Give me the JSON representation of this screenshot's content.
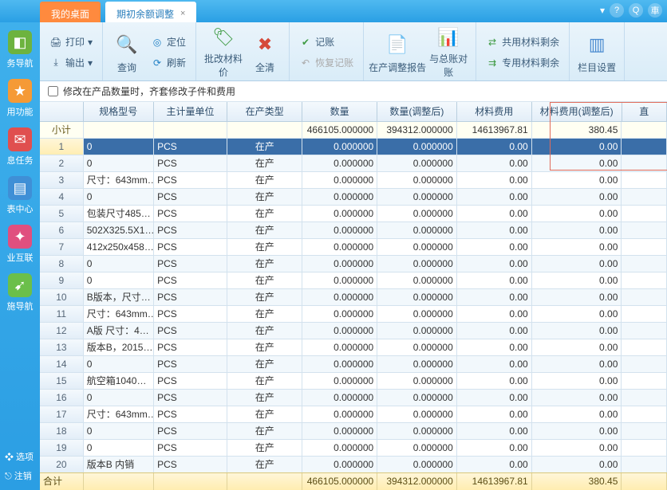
{
  "tabs": {
    "desktop": "我的桌面",
    "current": "期初余额调整"
  },
  "topbar_icons": {
    "help": "?",
    "search": "Q",
    "more": "車"
  },
  "sidebar": {
    "items": [
      {
        "label": "务导航",
        "icon_bg": "#6db33f",
        "icon": "◧"
      },
      {
        "label": "用功能",
        "icon_bg": "#f59a36",
        "icon": "★"
      },
      {
        "label": "息任务",
        "icon_bg": "#e04f4f",
        "icon": "✉"
      },
      {
        "label": "表中心",
        "icon_bg": "#3f8fd6",
        "icon": "▤"
      },
      {
        "label": "业互联",
        "icon_bg": "#e04f7f",
        "icon": "✦"
      },
      {
        "label": "施导航",
        "icon_bg": "#6bbf4a",
        "icon": "➹"
      }
    ],
    "bottom": {
      "options": "❖ 选项",
      "logout": "⎋ 注销"
    }
  },
  "ribbon": {
    "print": "打印",
    "export": "输出",
    "query": "查询",
    "locate": "定位",
    "refresh": "刷新",
    "batch_price": "批改材料价",
    "clear_all": "全清",
    "post": "记账",
    "restore_post": "恢复记账",
    "wip_report": "在产调整报告",
    "recon": "与总账对账",
    "share_mat": "共用材料剩余",
    "dedicate_mat": "专用材料剩余",
    "col_setup": "栏目设置"
  },
  "option": {
    "label": "修改在产品数量时，齐套修改子件和费用"
  },
  "grid": {
    "headers": [
      "",
      "规格型号",
      "主计量单位",
      "在产类型",
      "数量",
      "数量(调整后)",
      "材料费用",
      "材料费用(调整后)",
      "直"
    ],
    "subtotal_label": "小计",
    "subtotal": [
      "",
      "",
      "",
      "466105.000000",
      "394312.000000",
      "14613967.81",
      "380.45",
      ""
    ],
    "rows": [
      {
        "n": "1",
        "spec": "0",
        "uom": "PCS",
        "type": "在产",
        "qty": "0.000000",
        "qtya": "0.000000",
        "mat": "0.00",
        "mata": "0.00"
      },
      {
        "n": "2",
        "spec": "0",
        "uom": "PCS",
        "type": "在产",
        "qty": "0.000000",
        "qtya": "0.000000",
        "mat": "0.00",
        "mata": "0.00"
      },
      {
        "n": "3",
        "spec": "尺寸：643mm…",
        "uom": "PCS",
        "type": "在产",
        "qty": "0.000000",
        "qtya": "0.000000",
        "mat": "0.00",
        "mata": "0.00"
      },
      {
        "n": "4",
        "spec": "0",
        "uom": "PCS",
        "type": "在产",
        "qty": "0.000000",
        "qtya": "0.000000",
        "mat": "0.00",
        "mata": "0.00"
      },
      {
        "n": "5",
        "spec": "包装尺寸485…",
        "uom": "PCS",
        "type": "在产",
        "qty": "0.000000",
        "qtya": "0.000000",
        "mat": "0.00",
        "mata": "0.00"
      },
      {
        "n": "6",
        "spec": "502X325.5X1…",
        "uom": "PCS",
        "type": "在产",
        "qty": "0.000000",
        "qtya": "0.000000",
        "mat": "0.00",
        "mata": "0.00"
      },
      {
        "n": "7",
        "spec": "412x250x458…",
        "uom": "PCS",
        "type": "在产",
        "qty": "0.000000",
        "qtya": "0.000000",
        "mat": "0.00",
        "mata": "0.00"
      },
      {
        "n": "8",
        "spec": "0",
        "uom": "PCS",
        "type": "在产",
        "qty": "0.000000",
        "qtya": "0.000000",
        "mat": "0.00",
        "mata": "0.00"
      },
      {
        "n": "9",
        "spec": "0",
        "uom": "PCS",
        "type": "在产",
        "qty": "0.000000",
        "qtya": "0.000000",
        "mat": "0.00",
        "mata": "0.00"
      },
      {
        "n": "10",
        "spec": "B版本，尺寸…",
        "uom": "PCS",
        "type": "在产",
        "qty": "0.000000",
        "qtya": "0.000000",
        "mat": "0.00",
        "mata": "0.00"
      },
      {
        "n": "11",
        "spec": "尺寸：643mm…",
        "uom": "PCS",
        "type": "在产",
        "qty": "0.000000",
        "qtya": "0.000000",
        "mat": "0.00",
        "mata": "0.00"
      },
      {
        "n": "12",
        "spec": "A版 尺寸：4…",
        "uom": "PCS",
        "type": "在产",
        "qty": "0.000000",
        "qtya": "0.000000",
        "mat": "0.00",
        "mata": "0.00"
      },
      {
        "n": "13",
        "spec": "版本B，2015…",
        "uom": "PCS",
        "type": "在产",
        "qty": "0.000000",
        "qtya": "0.000000",
        "mat": "0.00",
        "mata": "0.00"
      },
      {
        "n": "14",
        "spec": "0",
        "uom": "PCS",
        "type": "在产",
        "qty": "0.000000",
        "qtya": "0.000000",
        "mat": "0.00",
        "mata": "0.00"
      },
      {
        "n": "15",
        "spec": "航空箱1040…",
        "uom": "PCS",
        "type": "在产",
        "qty": "0.000000",
        "qtya": "0.000000",
        "mat": "0.00",
        "mata": "0.00"
      },
      {
        "n": "16",
        "spec": "0",
        "uom": "PCS",
        "type": "在产",
        "qty": "0.000000",
        "qtya": "0.000000",
        "mat": "0.00",
        "mata": "0.00"
      },
      {
        "n": "17",
        "spec": "尺寸：643mm…",
        "uom": "PCS",
        "type": "在产",
        "qty": "0.000000",
        "qtya": "0.000000",
        "mat": "0.00",
        "mata": "0.00"
      },
      {
        "n": "18",
        "spec": "0",
        "uom": "PCS",
        "type": "在产",
        "qty": "0.000000",
        "qtya": "0.000000",
        "mat": "0.00",
        "mata": "0.00"
      },
      {
        "n": "19",
        "spec": "0",
        "uom": "PCS",
        "type": "在产",
        "qty": "0.000000",
        "qtya": "0.000000",
        "mat": "0.00",
        "mata": "0.00"
      },
      {
        "n": "20",
        "spec": "版本B 内销",
        "uom": "PCS",
        "type": "在产",
        "qty": "0.000000",
        "qtya": "0.000000",
        "mat": "0.00",
        "mata": "0.00"
      }
    ],
    "footer_label": "合计",
    "footer": [
      "",
      "",
      "",
      "466105.000000",
      "394312.000000",
      "14613967.81",
      "380.45",
      ""
    ]
  }
}
